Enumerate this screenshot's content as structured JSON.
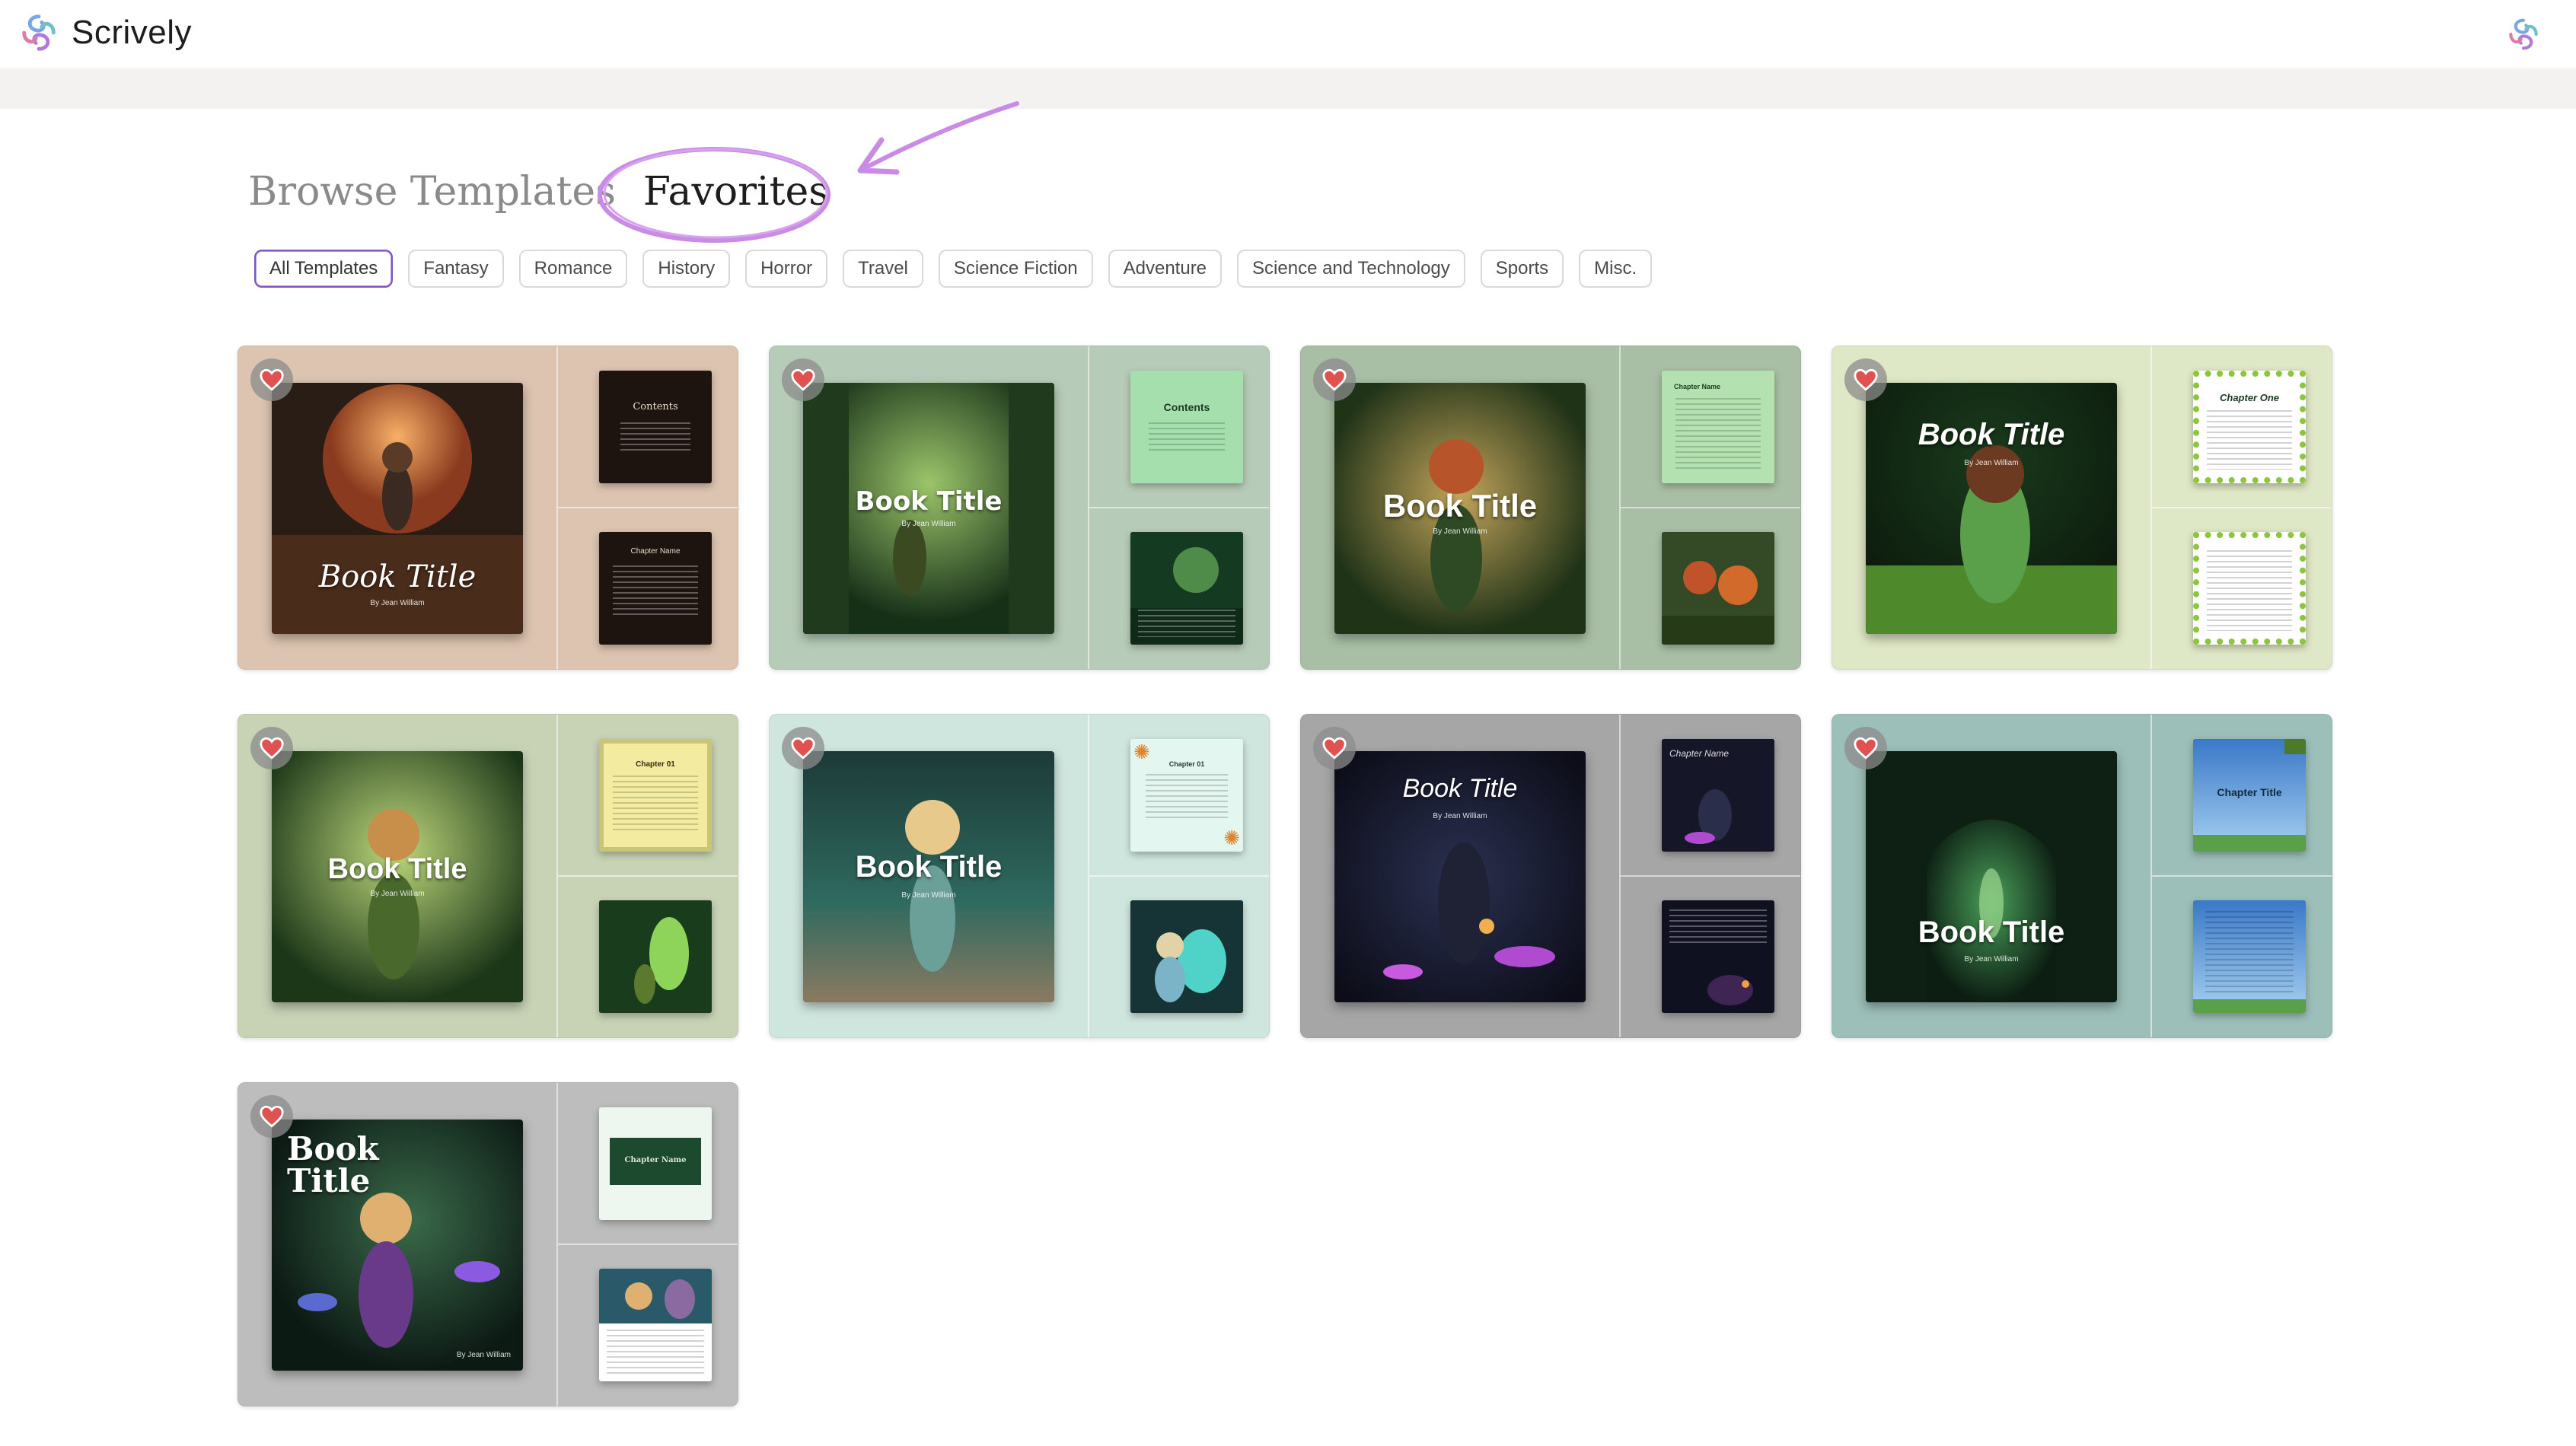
{
  "app": {
    "name": "Scrively"
  },
  "title": {
    "browse": "Browse Templates",
    "favorites": "Favorites"
  },
  "categories": [
    "All Templates",
    "Fantasy",
    "Romance",
    "History",
    "Horror",
    "Travel",
    "Science Fiction",
    "Adventure",
    "Science and Technology",
    "Sports",
    "Misc."
  ],
  "selected_category": "All Templates",
  "colors": {
    "accent": "#7b54c6",
    "heart": "#e0524f"
  },
  "templates": [
    {
      "cover_title": "Book Title",
      "author": "By Jean William",
      "page1_title": "Contents",
      "page2_title": "Chapter Name",
      "bg": "#dcc4b1"
    },
    {
      "cover_title": "Book Title",
      "author": "By Jean William",
      "page1_title": "Contents",
      "page2_title": "",
      "bg": "#b7ccb8"
    },
    {
      "cover_title": "Book Title",
      "author": "By Jean William",
      "page1_title": "Chapter Name",
      "page2_title": "",
      "bg": "#a9bfa5"
    },
    {
      "cover_title": "Book Title",
      "author": "By Jean William",
      "page1_title": "Chapter One",
      "page2_title": "",
      "bg": "#dfe8c6"
    },
    {
      "cover_title": "Book Title",
      "author": "By Jean William",
      "page1_title": "Chapter 01",
      "page2_title": "",
      "bg": "#c8d3b6"
    },
    {
      "cover_title": "Book Title",
      "author": "By Jean William",
      "page1_title": "Chapter 01",
      "page2_title": "",
      "bg": "#cfe6df"
    },
    {
      "cover_title": "Book Title",
      "author": "By Jean William",
      "page1_title": "Chapter Name",
      "page2_title": "",
      "bg": "#a6a6a6"
    },
    {
      "cover_title": "Book Title",
      "author": "By Jean William",
      "page1_title": "Chapter Title",
      "page2_title": "",
      "bg": "#9dbfb9"
    },
    {
      "cover_title": "Book Title",
      "author": "By Jean William",
      "page1_title": "Chapter Name",
      "page2_title": "",
      "bg": "#bdbdbd"
    }
  ]
}
